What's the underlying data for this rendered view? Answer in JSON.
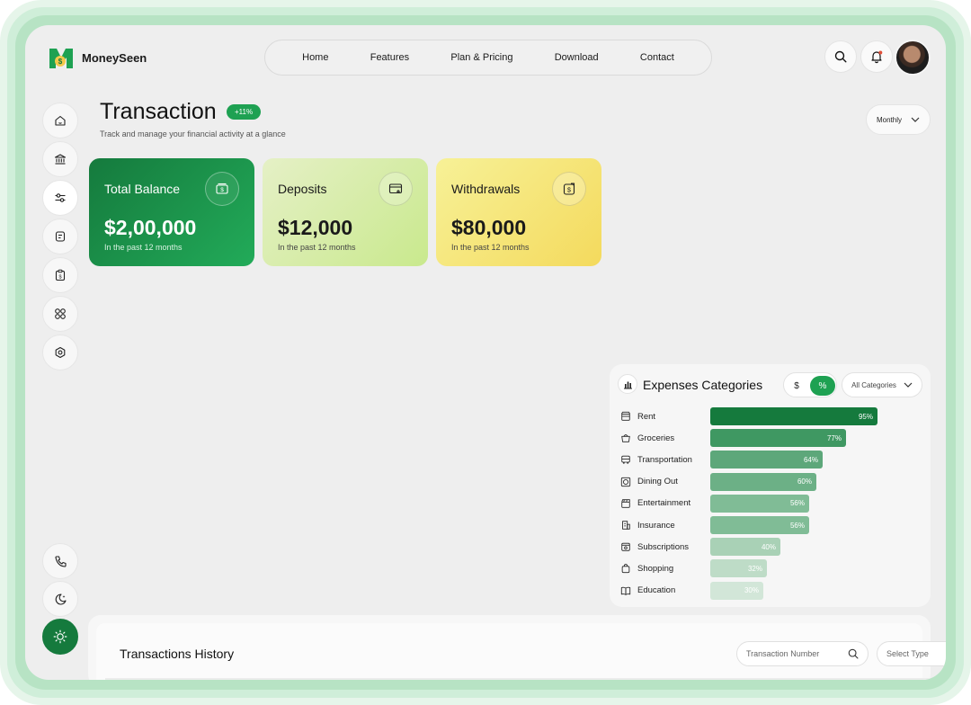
{
  "app": {
    "name": "MoneySeen"
  },
  "nav": {
    "items": [
      "Home",
      "Features",
      "Plan & Pricing",
      "Download",
      "Contact"
    ]
  },
  "header": {
    "icons": [
      "search-icon",
      "bell-icon"
    ],
    "avatar": "user-avatar"
  },
  "sidebar": {
    "items": [
      "home-icon",
      "bank-icon",
      "sliders-icon",
      "receipt-icon",
      "clipboard-icon",
      "apps-icon",
      "settings-icon"
    ],
    "active_index": 2,
    "bottom": [
      "phone-icon",
      "moon-icon",
      "sun-icon"
    ]
  },
  "page": {
    "title": "Transaction",
    "growth_badge": "+11%",
    "subtitle": "Track and manage your financial activity at a glance",
    "period": "Monthly"
  },
  "cards": [
    {
      "label": "Total Balance",
      "value": "$2,00,000",
      "sub": "In the past 12 months",
      "icon": "money-icon"
    },
    {
      "label": "Deposits",
      "value": "$12,000",
      "sub": "In the past 12 months",
      "icon": "card-add-icon"
    },
    {
      "label": "Withdrawals",
      "value": "$80,000",
      "sub": "In the past 12 months",
      "icon": "withdraw-icon"
    }
  ],
  "expenses": {
    "title": "Expenses Categories",
    "toggle": {
      "dollar": "$",
      "percent": "%",
      "selected": "percent"
    },
    "filter": "All Categories",
    "items": [
      {
        "label": "Rent",
        "value": 95,
        "display": "95%",
        "icon": "shop-icon",
        "color": "#157a3d"
      },
      {
        "label": "Groceries",
        "value": 77,
        "display": "77%",
        "icon": "basket-icon",
        "color": "#3f9862"
      },
      {
        "label": "Transportation",
        "value": 64,
        "display": "64%",
        "icon": "bus-icon",
        "color": "#5da77a"
      },
      {
        "label": "Dining Out",
        "value": 60,
        "display": "60%",
        "icon": "plate-icon",
        "color": "#6cb086"
      },
      {
        "label": "Entertainment",
        "value": 56,
        "display": "56%",
        "icon": "clapper-icon",
        "color": "#80bc96"
      },
      {
        "label": "Insurance",
        "value": 56,
        "display": "56%",
        "icon": "building-icon",
        "color": "#80bc96"
      },
      {
        "label": "Subscriptions",
        "value": 40,
        "display": "40%",
        "icon": "subscription-icon",
        "color": "#a9d1b6"
      },
      {
        "label": "Shopping",
        "value": 32,
        "display": "32%",
        "icon": "bag-icon",
        "color": "#bedcc7"
      },
      {
        "label": "Education",
        "value": 30,
        "display": "30%",
        "icon": "book-icon",
        "color": "#d2e6d8"
      }
    ]
  },
  "history": {
    "title": "Transactions History",
    "search_placeholder": "Transaction Number",
    "select_placeholder": "Select Type"
  }
}
